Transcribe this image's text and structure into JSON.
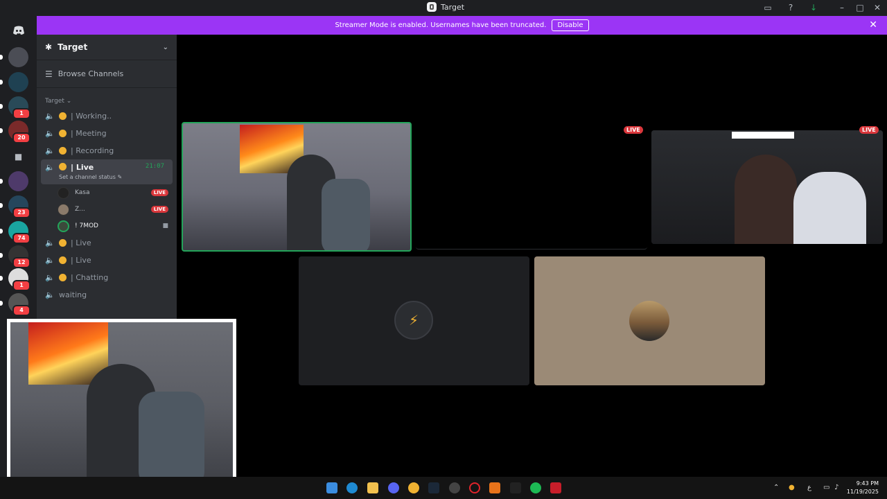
{
  "window": {
    "title": "Target"
  },
  "banner": {
    "message": "Streamer Mode is enabled. Usernames have been truncated.",
    "disable_label": "Disable",
    "color": "#9b35f5"
  },
  "rail": {
    "badges": [
      "1",
      "20",
      "23",
      "74",
      "12",
      "1",
      "4"
    ]
  },
  "guild": {
    "name": "Target",
    "browse_label": "Browse Channels",
    "category": "Target"
  },
  "channels": [
    {
      "name": "| Working..",
      "dot": true
    },
    {
      "name": "| Meeting",
      "dot": true
    },
    {
      "name": "| Recording",
      "dot": true
    },
    {
      "name": "| Live",
      "dot": true,
      "active": true,
      "time": "21:07",
      "status": "Set a channel status"
    },
    {
      "name": "| Live",
      "dot": true
    },
    {
      "name": "| Live",
      "dot": true
    },
    {
      "name": "| Chatting",
      "dot": true
    },
    {
      "name": "waiting",
      "dot": false
    }
  ],
  "members": [
    {
      "name": "Kasa",
      "live": "LIVE"
    },
    {
      "name": "Z...",
      "live": "LIVE"
    },
    {
      "name": "! 7MOD",
      "camera": true
    }
  ],
  "stage": {
    "live_label": "LIVE"
  },
  "taskbar": {
    "time": "9:43 PM",
    "date": "11/19/2025",
    "lang": "ع"
  },
  "colors": {
    "live": "#da373c",
    "speaking_border": "#23a55a",
    "dot": "#f0b232"
  }
}
